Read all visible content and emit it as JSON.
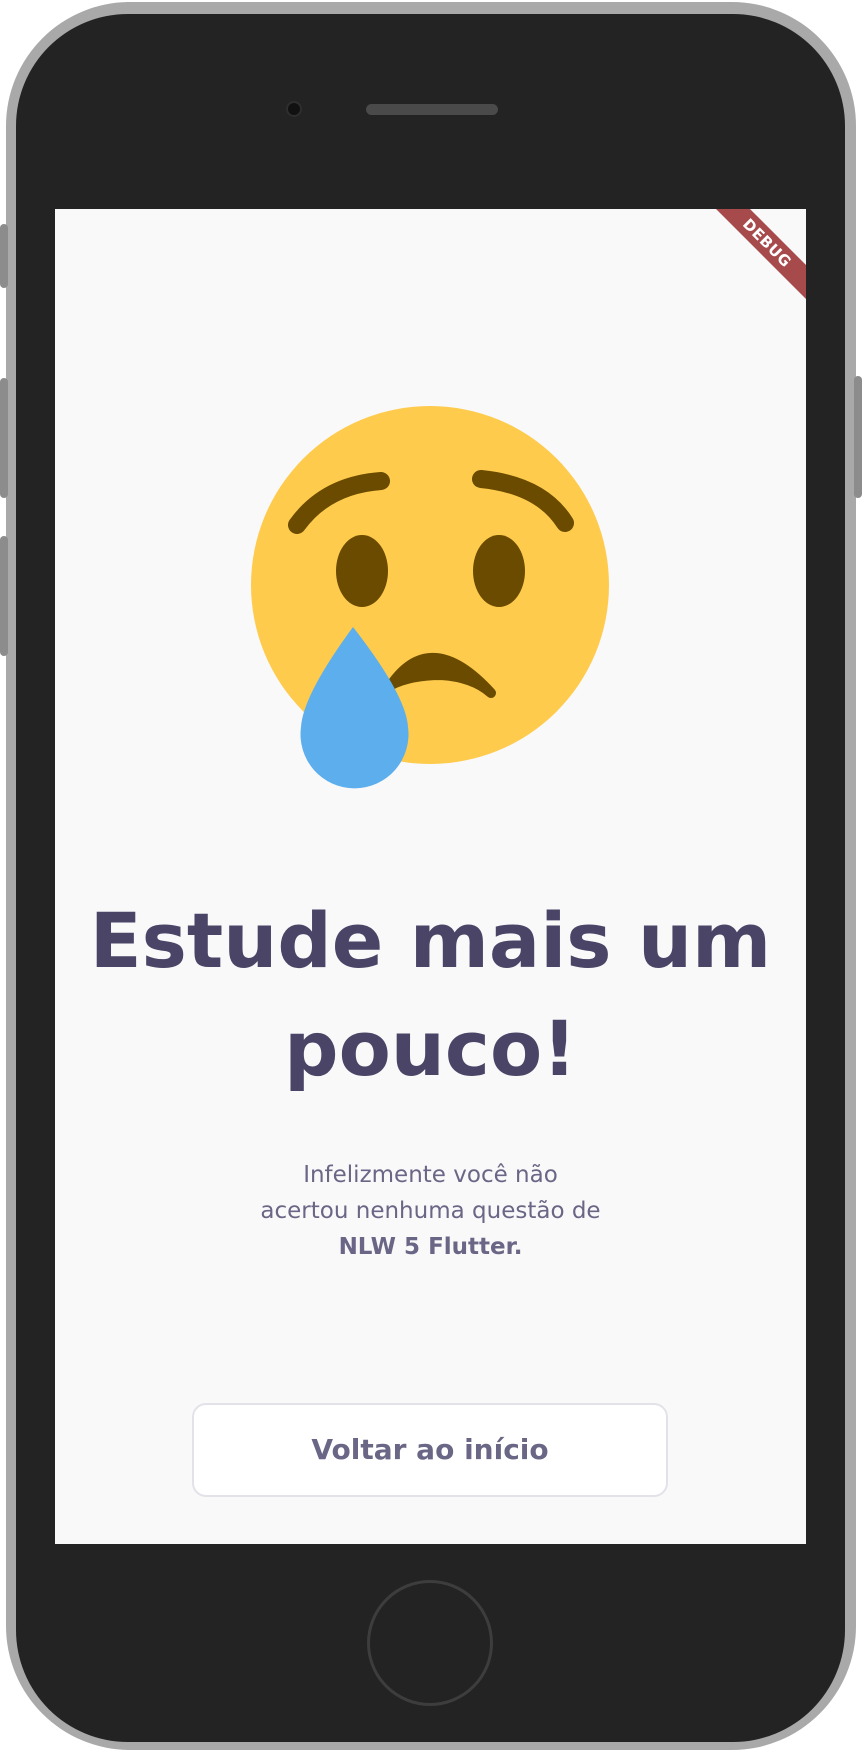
{
  "debug_banner": "DEBUG",
  "result": {
    "emoji": "crying-face-icon",
    "title_line1": "Estude mais um",
    "title_line2": "pouco!",
    "message_line1": "Infelizmente você não",
    "message_line2": "acertou nenhuma questão de",
    "quiz_name": "NLW 5 Flutter."
  },
  "actions": {
    "back_label": "Voltar ao início"
  },
  "colors": {
    "title": "#4a4466",
    "text": "#6a6685",
    "background": "#f9f9fa",
    "emoji_face": "#fecb4d",
    "emoji_features": "#6a4b00",
    "tear": "#5daeed",
    "debug_banner": "#a64a4c"
  }
}
